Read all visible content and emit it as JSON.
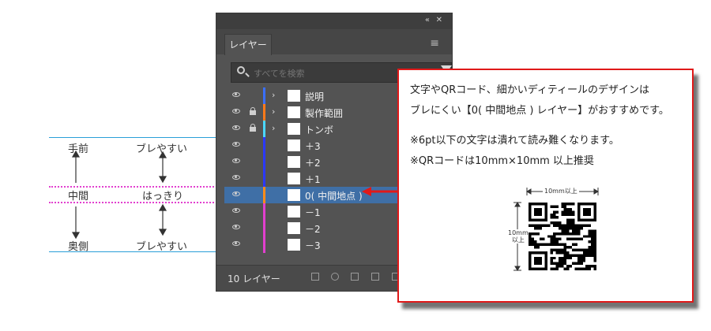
{
  "annotations": {
    "left": {
      "front_label": "手前",
      "front_desc": "ブレやすい",
      "middle_label": "中間",
      "middle_desc": "はっきり",
      "back_label": "奥側",
      "back_desc": "ブレやすい"
    }
  },
  "panel": {
    "tab_label": "レイヤー",
    "collapse_icon": "double-chevron-icon",
    "close_icon": "close-icon",
    "menu_icon": "hamburger-icon",
    "search_placeholder": "すべてを検索",
    "layers": [
      {
        "name": "説明",
        "color": "#3a6fff",
        "locked": false,
        "chevron": true,
        "selected": false
      },
      {
        "name": "製作範囲",
        "color": "#ff7a1a",
        "locked": true,
        "chevron": true,
        "selected": false
      },
      {
        "name": "トンボ",
        "color": "#4bd7ff",
        "locked": true,
        "chevron": true,
        "selected": false
      },
      {
        "name": "＋3",
        "color": "#2b39ff",
        "locked": false,
        "chevron": false,
        "selected": false
      },
      {
        "name": "＋2",
        "color": "#2b39ff",
        "locked": false,
        "chevron": false,
        "selected": false
      },
      {
        "name": "＋1",
        "color": "#2b39ff",
        "locked": false,
        "chevron": false,
        "selected": false
      },
      {
        "name": "0( 中間地点 )",
        "color": "#ff8c1a",
        "locked": false,
        "chevron": false,
        "selected": true
      },
      {
        "name": "－1",
        "color": "#e23fcf",
        "locked": false,
        "chevron": false,
        "selected": false
      },
      {
        "name": "－2",
        "color": "#e23fcf",
        "locked": false,
        "chevron": false,
        "selected": false
      },
      {
        "name": "－3",
        "color": "#e23fcf",
        "locked": false,
        "chevron": false,
        "selected": false
      }
    ],
    "layer_count": "10 レイヤー"
  },
  "callout": {
    "line1": "文字やQRコード、細かいディティールのデザインは",
    "line2": "ブレにくい【0( 中間地点 ) レイヤー】がおすすめです。",
    "note1": "※6pt以下の文字は潰れて読み難くなります。",
    "note2": "※QRコードは10mm×10mm 以上推奨",
    "dim_top": "10mm以上",
    "dim_side_1": "10mm",
    "dim_side_2": "以上"
  },
  "colors": {
    "callout_border": "#e01919",
    "blue_line": "#2a9fd8",
    "magenta_line": "#e23fcf",
    "selected_row": "#3f6fa6"
  }
}
